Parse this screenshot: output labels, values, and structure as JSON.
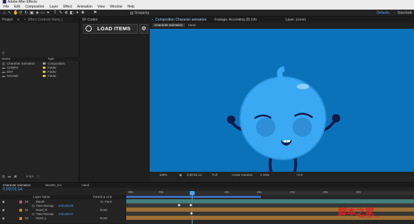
{
  "app": {
    "title": "Adobe After Effects"
  },
  "menu": [
    "File",
    "Edit",
    "Composition",
    "Layer",
    "Effect",
    "Animation",
    "View",
    "Window",
    "Help"
  ],
  "toolbar": {
    "snapping": "Snapping",
    "workspace_default": "Default",
    "workspace_standard": "Standard",
    "more": "»"
  },
  "project": {
    "tab_label": "Project",
    "effect_tab_label": "Effect Controls Hand_L",
    "header_name": "Name",
    "header_type": "Type",
    "items": [
      {
        "name": "Character animation",
        "type": "Composition",
        "color": "#a2a2a2"
      },
      {
        "name": "COMPS",
        "type": "Folder",
        "color": "#e3c52a"
      },
      {
        "name": "MAT",
        "type": "Folder",
        "color": "#e3c52a"
      },
      {
        "name": "SOUND",
        "type": "Folder",
        "color": "#e3c52a"
      }
    ],
    "bpc": "8 bpc"
  },
  "sf_codes": {
    "tab_label": "SF Codes",
    "load_label": "LOAD ITEMS",
    "gear": "⚙"
  },
  "comp": {
    "tab_comp": "Composition Character animation",
    "tab_footage": "Footage: Accending (8) Info",
    "tab_layer": "Layer: (none)",
    "sub_tab_active": "Character animation",
    "sub_tab_other": "Hand",
    "zoom": "100%",
    "timecode": "0;00;01;14",
    "resolution": "Full",
    "camera": "Active Camera",
    "view": "1 View",
    "exposure": "+0.0"
  },
  "timeline": {
    "tab_main": "Character animation",
    "tab_mouth": "Mouths_cnt",
    "tab_hand": "Hand",
    "timecode": "0;00;01;14",
    "header_layer": "Layer Name",
    "header_parent": "Parent & Link",
    "ruler": [
      "00s",
      "05s",
      "10s",
      "15s",
      "20s",
      "25s",
      "30s"
    ],
    "layers": [
      {
        "num": "26",
        "name": "Mouth",
        "parent": "11. Face",
        "color": "#c2567a"
      },
      {
        "num": "",
        "name": "Time Remap",
        "parent": "0;00;00;00",
        "color": ""
      },
      {
        "num": "31",
        "name": "Hand_R",
        "parent": "None",
        "color": "#c98a3e"
      },
      {
        "num": "",
        "name": "Time Remap",
        "parent": "0;00;00;07",
        "color": ""
      },
      {
        "num": "33",
        "name": "Hand_L",
        "parent": "None",
        "color": "#c98a3e"
      }
    ],
    "bars": [
      {
        "color": "#4a8f8c",
        "start": 0.0,
        "end": 1.0
      },
      {
        "color": "#3a3a3a",
        "start": 0.0,
        "end": 1.0
      },
      {
        "color": "#b27d3a",
        "start": 0.0,
        "end": 1.0
      },
      {
        "color": "#3a3a3a",
        "start": 0.0,
        "end": 1.0
      },
      {
        "color": "#b27d3a",
        "start": 0.0,
        "end": 1.0
      }
    ]
  },
  "watermark": {
    "text": "脚本之家",
    "url": "www.jb51.net"
  }
}
